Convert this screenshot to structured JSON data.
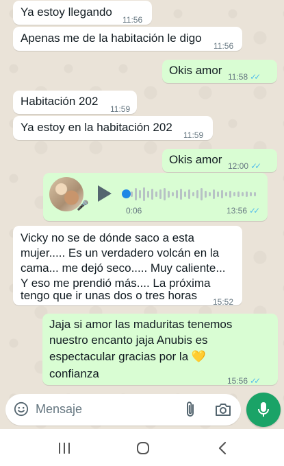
{
  "messages": [
    {
      "text": "Ya estoy llegando",
      "time": "11:56"
    },
    {
      "text": "Apenas me de la habitación le digo",
      "time": "11:56"
    },
    {
      "text": "Okis amor",
      "time": "11:58"
    },
    {
      "text": "Habitación 202",
      "time": "11:59"
    },
    {
      "text": "Ya estoy en la habitación 202",
      "time": "11:59"
    },
    {
      "text": "Okis amor",
      "time": "12:00"
    },
    {
      "voice_duration": "0:06",
      "time": "13:56"
    },
    {
      "lines": [
        "Vicky no se de dónde saco a esta",
        "mujer..... Es un verdadero volcán en la",
        "cama... me dejó seco..... Muy caliente...",
        "Y eso me prendió más.... La próxima",
        "tengo que ir unas dos o tres horas"
      ],
      "time": "15:52"
    },
    {
      "lines": [
        "Jaja si amor las maduritas tenemos",
        "nuestro encanto jaja Anubis es",
        "espectacular gracias por la",
        "confianza"
      ],
      "emoji": "💛",
      "time": "15:56"
    }
  ],
  "input": {
    "placeholder": "Mensaje"
  },
  "colors": {
    "incoming": "#ffffff",
    "outgoing": "#d9fdd3",
    "accent": "#1aa367",
    "read_ticks": "#53bdeb"
  },
  "icons": [
    "emoji-icon",
    "attach-icon",
    "camera-icon",
    "mic-icon",
    "recent-apps-icon",
    "home-icon",
    "back-icon"
  ]
}
